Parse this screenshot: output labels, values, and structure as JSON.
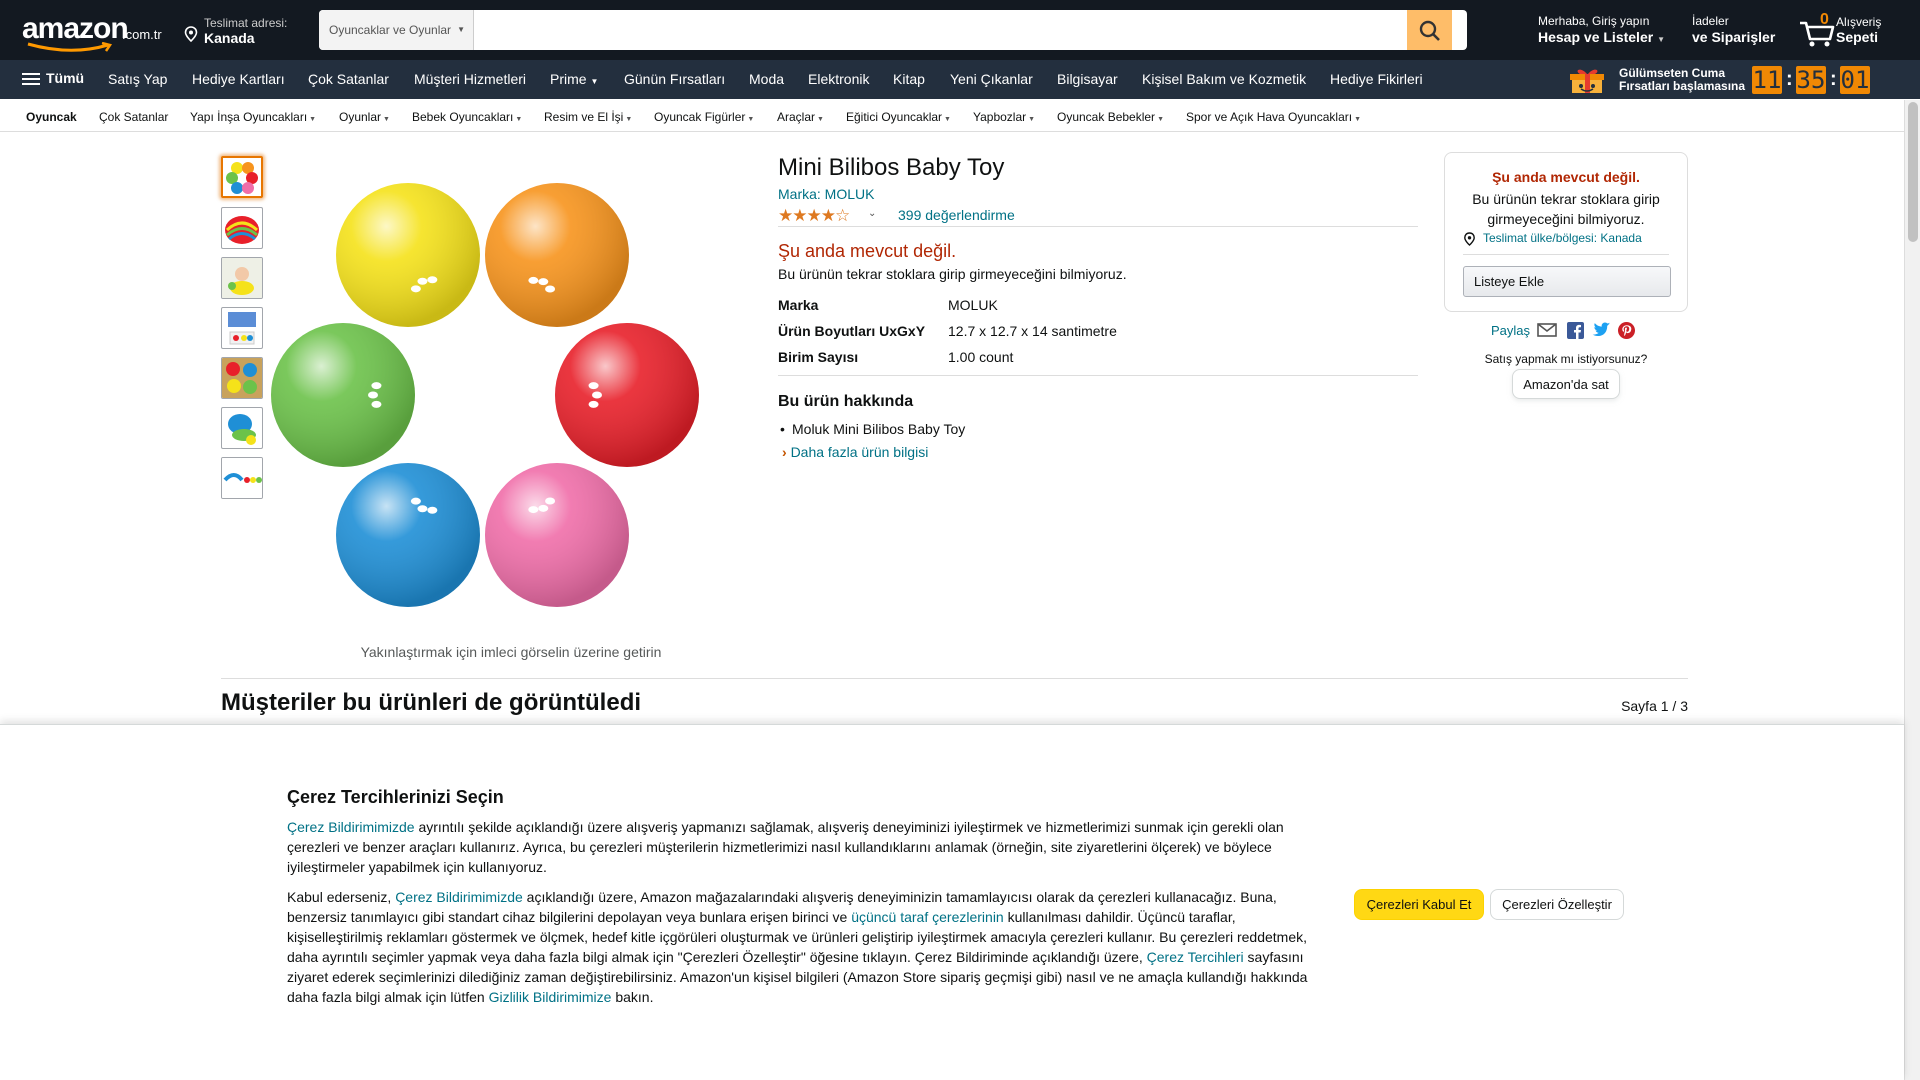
{
  "header": {
    "logo_text": "amazon",
    "logo_tld": ".com.tr",
    "deliver_label": "Teslimat adresi:",
    "deliver_country": "Kanada",
    "search_category": "Oyuncaklar ve Oyunlar",
    "search_placeholder": "",
    "account_line1": "Merhaba, Giriş yapın",
    "account_line2": "Hesap ve Listeler",
    "orders_line1": "İadeler",
    "orders_line2": "ve Siparişler",
    "cart_count": "0",
    "cart_line1": "Alışveriş",
    "cart_line2": "Sepeti"
  },
  "main_nav": {
    "all_label": "Tümü",
    "items": [
      "Satış Yap",
      "Hediye Kartları",
      "Çok Satanlar",
      "Müşteri Hizmetleri",
      "Prime",
      "Günün Fırsatları",
      "Moda",
      "Elektronik",
      "Kitap",
      "Yeni Çıkanlar",
      "Bilgisayar",
      "Kişisel Bakım ve Kozmetik",
      "Hediye Fikirleri"
    ],
    "promo_line1": "Gülümseten Cuma",
    "promo_line2": "Fırsatları başlamasına",
    "timer": [
      "11",
      "35",
      "01"
    ]
  },
  "sub_nav": {
    "items": [
      "Oyuncak",
      "Çok Satanlar",
      "Yapı İnşa Oyuncakları",
      "Oyunlar",
      "Bebek Oyuncakları",
      "Resim ve El İşi",
      "Oyuncak Figürler",
      "Araçlar",
      "Eğitici Oyuncaklar",
      "Yapbozlar",
      "Oyuncak Bebekler",
      "Spor ve Açık Hava Oyuncakları"
    ]
  },
  "gallery": {
    "zoom_hint": "Yakınlaştırmak için imleci görselin üzerine getirin",
    "ball_colors": [
      "#f5e21a",
      "#f7941d",
      "#e8202a",
      "#f06ea9",
      "#1f8fd6",
      "#6cc24a"
    ]
  },
  "product": {
    "title": "Mini Bilibos Baby Toy",
    "brand_link": "Marka: MOLUK",
    "stars": "★★★★☆",
    "rating_count": "399 değerlendirme",
    "unavailable": "Şu anda mevcut değil.",
    "unavailable_sub": "Bu ürünün tekrar stoklara girip girmeyeceğini bilmiyoruz.",
    "specs": [
      {
        "key": "Marka",
        "value": "MOLUK"
      },
      {
        "key": "Ürün Boyutları UxGxY",
        "value": "12.7 x 12.7 x 14 santimetre"
      },
      {
        "key": "Birim Sayısı",
        "value": "1.00 count"
      }
    ],
    "about_heading": "Bu ürün hakkında",
    "about_items": [
      "Moluk Mini Bilibos Baby Toy"
    ],
    "more_info": "Daha fazla ürün bilgisi"
  },
  "buybox": {
    "unavailable": "Şu anda mevcut değil.",
    "sub": "Bu ürünün tekrar stoklara girip girmeyeceğini bilmiyoruz.",
    "location": "Teslimat ülke/bölgesi: Kanada",
    "add_list": "Listeye Ekle",
    "share": "Paylaş",
    "sell_question": "Satış yapmak mı istiyorsunuz?",
    "sell_button": "Amazon'da sat"
  },
  "viewed": {
    "heading": "Müşteriler bu ürünleri de görüntüledi",
    "page": "Sayfa 1 / 3"
  },
  "cookie": {
    "heading": "Çerez Tercihlerinizi Seçin",
    "p1_link": "Çerez Bildirimimizde",
    "p1_text": " ayrıntılı şekilde açıklandığı üzere alışveriş yapmanızı sağlamak, alışveriş deneyiminizi iyileştirmek ve hizmetlerimizi sunmak için gerekli olan çerezleri ve benzer araçları kullanırız. Ayrıca, bu çerezleri müşterilerin hizmetlerimizi nasıl kullandıklarını anlamak (örneğin, site ziyaretlerini ölçerek) ve böylece iyileştirmeler yapabilmek için kullanıyoruz.",
    "p2_a": "Kabul ederseniz, ",
    "p2_link1": "Çerez Bildirimimizde",
    "p2_b": " açıklandığı üzere, Amazon mağazalarındaki alışveriş deneyiminizin tamamlayıcısı olarak da çerezleri kullanacağız. Buna, benzersiz tanımlayıcı gibi standart cihaz bilgilerini depolayan veya bunlara erişen birinci ve ",
    "p2_link2": "üçüncü taraf çerezlerinin",
    "p2_c": " kullanılması dahildir. Üçüncü taraflar, kişiselleştirilmiş reklamları göstermek ve ölçmek, hedef kitle içgörüleri oluşturmak ve ürünleri geliştirip iyileştirmek amacıyla çerezleri kullanır. Bu çerezleri reddetmek, daha ayrıntılı seçimler yapmak veya daha fazla bilgi almak için \"Çerezleri Özelleştir\" öğesine tıklayın. Çerez Bildiriminde açıklandığı üzere, ",
    "p2_link3": "Çerez Tercihleri",
    "p2_d": " sayfasını ziyaret ederek seçimlerinizi dilediğiniz zaman değiştirebilirsiniz. Amazon'un kişisel bilgileri (Amazon Store sipariş geçmişi gibi) nasıl ve ne amaçla kullandığı hakkında daha fazla bilgi almak için lütfen ",
    "p2_link4": "Gizlilik Bildirimimize",
    "p2_e": " bakın.",
    "accept": "Çerezleri Kabul Et",
    "customize": "Çerezleri Özelleştir"
  }
}
